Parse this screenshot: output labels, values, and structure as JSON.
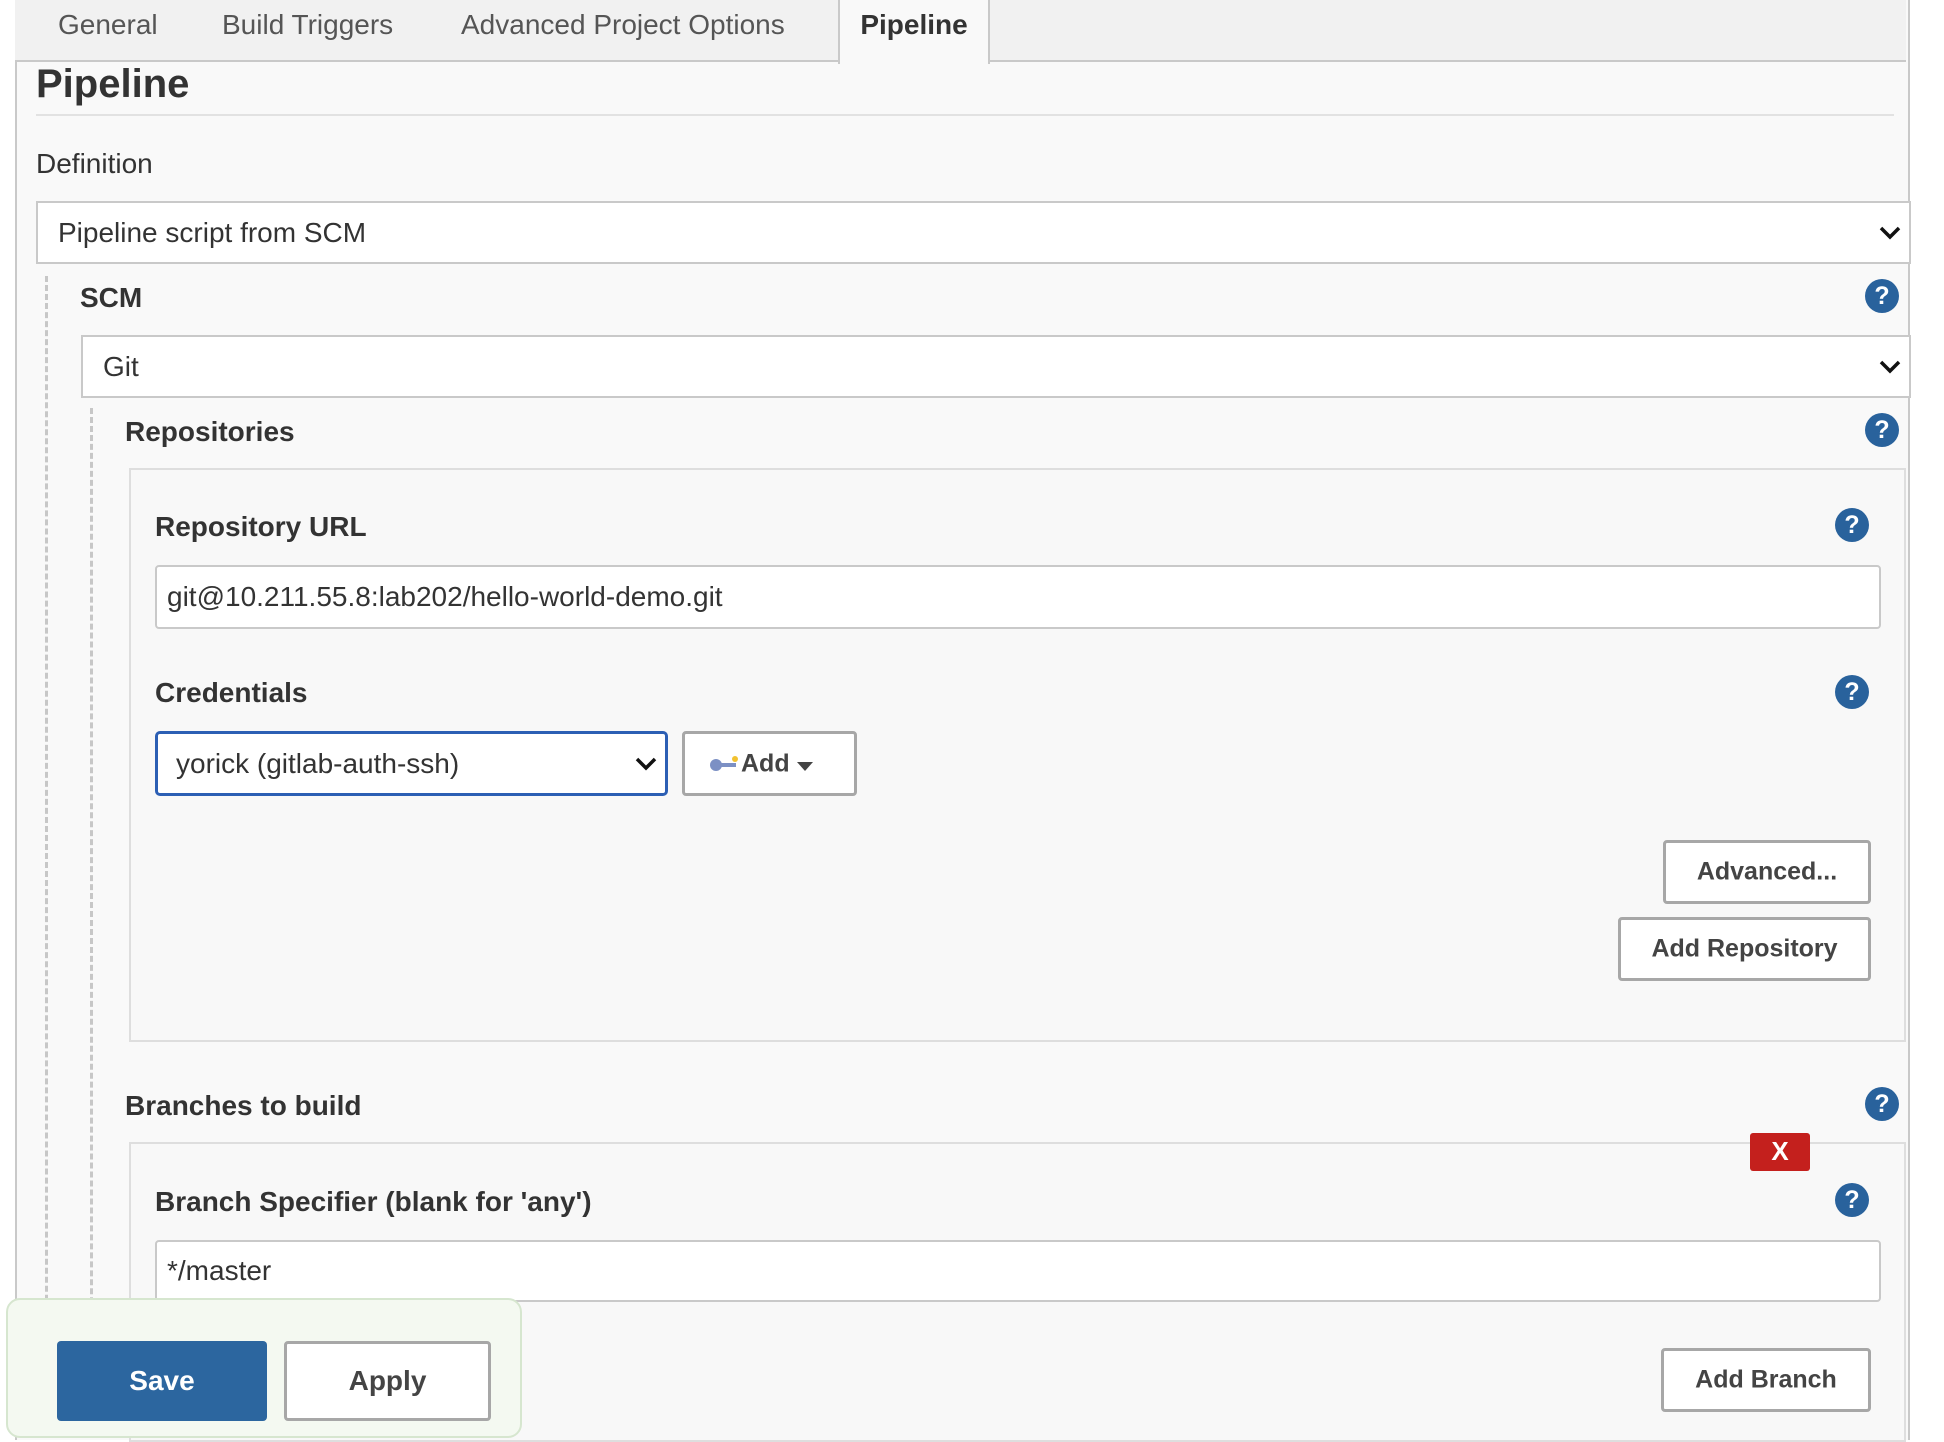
{
  "tabs": [
    {
      "label": "General",
      "active": false
    },
    {
      "label": "Build Triggers",
      "active": false
    },
    {
      "label": "Advanced Project Options",
      "active": false
    },
    {
      "label": "Pipeline",
      "active": true
    }
  ],
  "section": {
    "title": "Pipeline"
  },
  "definition": {
    "label": "Definition",
    "value": "Pipeline script from SCM"
  },
  "scm": {
    "label": "SCM",
    "value": "Git"
  },
  "repositories": {
    "label": "Repositories",
    "repository_url": {
      "label": "Repository URL",
      "value": "git@10.211.55.8:lab202/hello-world-demo.git"
    },
    "credentials": {
      "label": "Credentials",
      "value": "yorick (gitlab-auth-ssh)",
      "add_label": "Add"
    },
    "advanced_label": "Advanced...",
    "add_repository_label": "Add Repository"
  },
  "branches": {
    "label": "Branches to build",
    "delete_label": "X",
    "specifier_label": "Branch Specifier (blank for 'any')",
    "specifier_value": "*/master",
    "add_branch_label": "Add Branch"
  },
  "help_label": "?",
  "actions": {
    "save_label": "Save",
    "apply_label": "Apply"
  },
  "colors": {
    "primary": "#2c669f",
    "help": "#29629c",
    "danger": "#c4201d",
    "focus": "#2c5fb4"
  }
}
